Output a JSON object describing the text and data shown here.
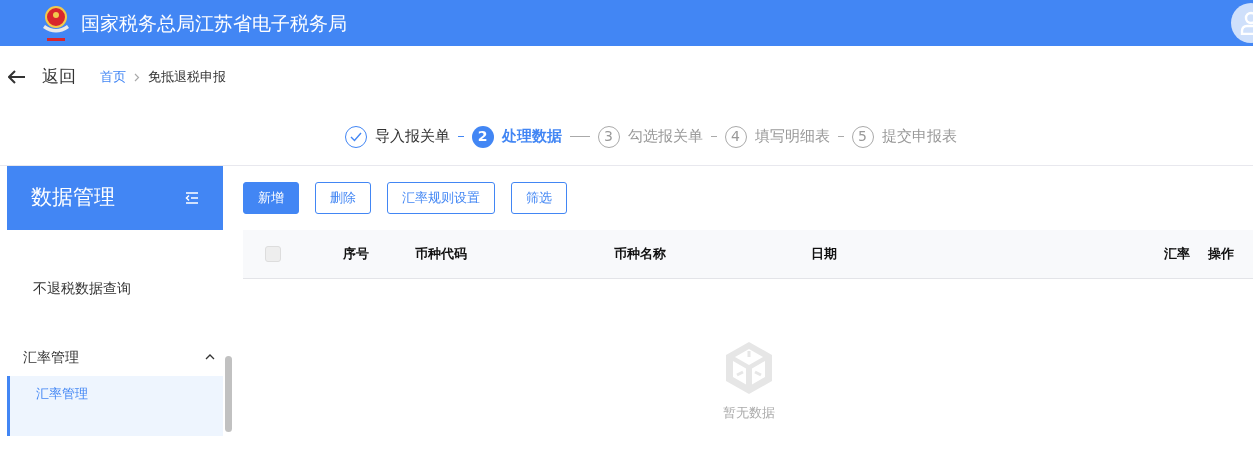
{
  "header": {
    "title": "国家税务总局江苏省电子税务局"
  },
  "back": {
    "label": "返回"
  },
  "breadcrumb": [
    {
      "label": "首页",
      "link": true
    },
    {
      "label": "免抵退税申报",
      "link": false
    }
  ],
  "steps": [
    {
      "done": true,
      "selected": false,
      "label": "导入报关单"
    },
    {
      "done": false,
      "selected": true,
      "number": "2",
      "label": "处理数据"
    },
    {
      "done": false,
      "selected": false,
      "number": "3",
      "label": "勾选报关单"
    },
    {
      "done": false,
      "selected": false,
      "number": "4",
      "label": "填写明细表"
    },
    {
      "done": false,
      "selected": false,
      "number": "5",
      "label": "提交申报表"
    }
  ],
  "sidebar": {
    "title": "数据管理",
    "items": [
      {
        "kind": "item",
        "label": "不退税数据查询",
        "selected": false
      },
      {
        "kind": "group",
        "label": "汇率管理",
        "expanded": true,
        "children": [
          {
            "label": "汇率管理",
            "selected": true
          }
        ]
      }
    ]
  },
  "toolbar": [
    {
      "label": "新增",
      "primary": true
    },
    {
      "label": "删除",
      "primary": false
    },
    {
      "label": "汇率规则设置",
      "primary": false
    },
    {
      "label": "筛选",
      "primary": false
    }
  ],
  "table": {
    "header_checkbox": {
      "checked": false,
      "disabled": true
    },
    "columns": [
      "序号",
      "币种代码",
      "币种名称",
      "日期",
      "汇率",
      "操作"
    ],
    "empty_text": "暂无数据"
  }
}
